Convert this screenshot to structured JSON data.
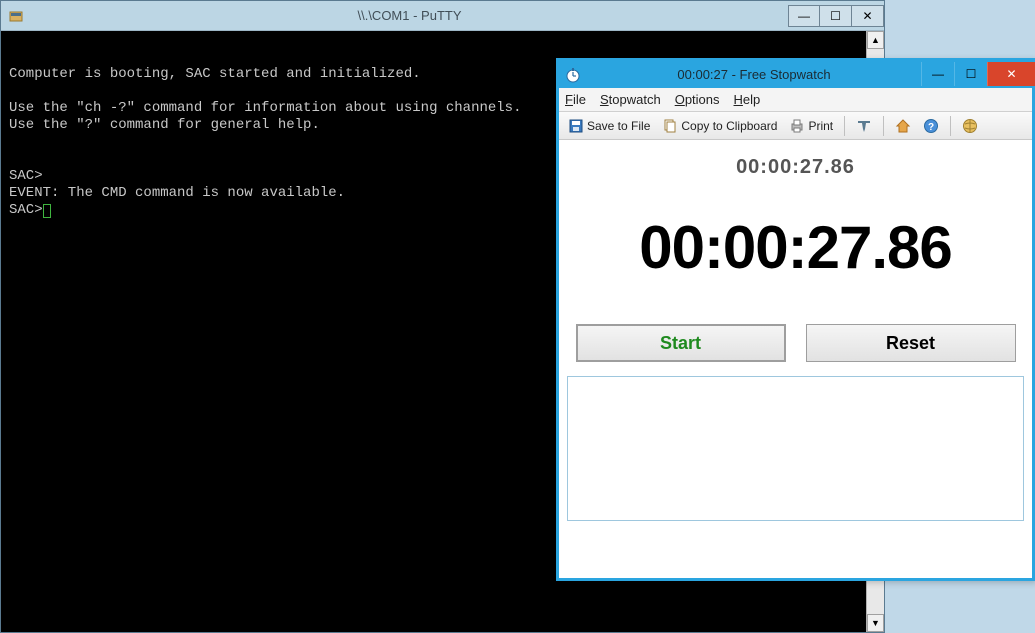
{
  "putty": {
    "title": "\\\\.\\COM1 - PuTTY",
    "terminal_lines": [
      "",
      "Computer is booting, SAC started and initialized.",
      "",
      "Use the \"ch -?\" command for information about using channels.",
      "Use the \"?\" command for general help.",
      "",
      "",
      "SAC>",
      "EVENT: The CMD command is now available.",
      "SAC>"
    ]
  },
  "stopwatch": {
    "title": "00:00:27 - Free Stopwatch",
    "menu": {
      "file": "File",
      "stopwatch": "Stopwatch",
      "options": "Options",
      "help": "Help"
    },
    "toolbar": {
      "save": "Save to File",
      "copy": "Copy to Clipboard",
      "print": "Print"
    },
    "small_time": "00:00:27.86",
    "big_time": "00:00:27.86",
    "start_label": "Start",
    "reset_label": "Reset"
  },
  "glyphs": {
    "min": "—",
    "max": "☐",
    "close": "✕",
    "up": "▲",
    "down": "▼"
  }
}
